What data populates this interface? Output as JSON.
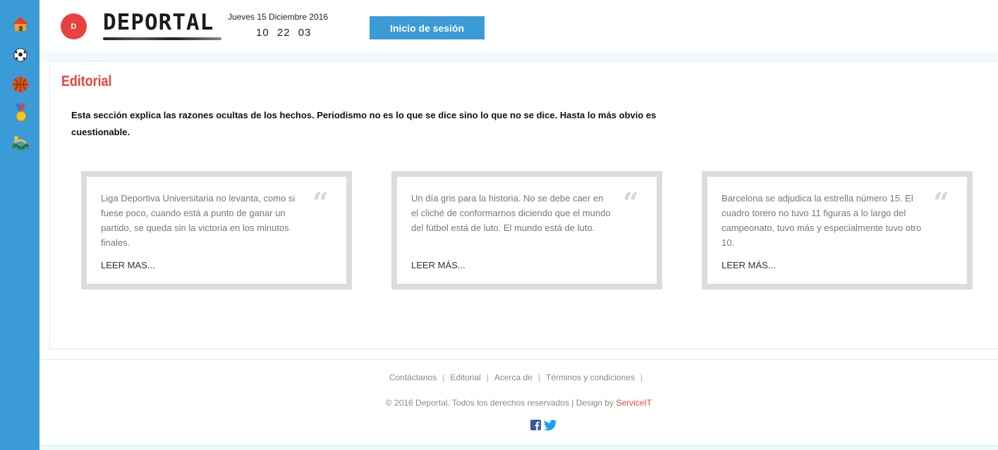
{
  "header": {
    "badge_text": "D",
    "logo_text": "DEPORTAL",
    "date": "Jueves 15 Diciembre 2016",
    "clock": "10  22  03",
    "login_label": "Inicio de sesión"
  },
  "sidebar": {
    "items": [
      {
        "icon": "home-icon"
      },
      {
        "icon": "soccer-ball-icon"
      },
      {
        "icon": "basketball-icon"
      },
      {
        "icon": "medal-icon"
      },
      {
        "icon": "swimmer-icon"
      }
    ]
  },
  "main": {
    "title": "Editorial",
    "intro": "Esta sección explica las razones ocultas de los hechos. Periodismo no es lo que se dice sino lo que no se dice. Hasta lo más obvio es cuestionable.",
    "quote_mark": "“",
    "cards": [
      {
        "text": "Liga Deportiva Universitaria no levanta, como si fuese poco, cuando está a punto de ganar un partido, se queda sin la victoria en los minutos finales.",
        "link": "LEER MAS..."
      },
      {
        "text": "Un día gris para la historia. No se debe caer en el cliché de conformarnos diciendo que el mundo del fútbol está de luto. El mundo está de luto.",
        "link": "LEER MÁS..."
      },
      {
        "text": "Barcelona se adjudica la estrella número 15. El cuadro torero no tuvo 11 figuras a lo largo del campeonato, tuvo más y especialmente tuvo otro 10.",
        "link": "LEER MÁS..."
      }
    ]
  },
  "footer": {
    "links": [
      "Contáctanos",
      "Editorial",
      "Acerca de",
      "Términos y condiciones"
    ],
    "separator": "|",
    "copyright": "© 2016 Deportal. Todos los derechos reservados",
    "design_prefix": "| Design by",
    "design_brand": "ServiceIT",
    "social": [
      "facebook-icon",
      "twitter-icon"
    ]
  },
  "colors": {
    "accent_blue": "#3a9bd6",
    "accent_red": "#e8423f",
    "card_border": "#dcdcdc"
  }
}
